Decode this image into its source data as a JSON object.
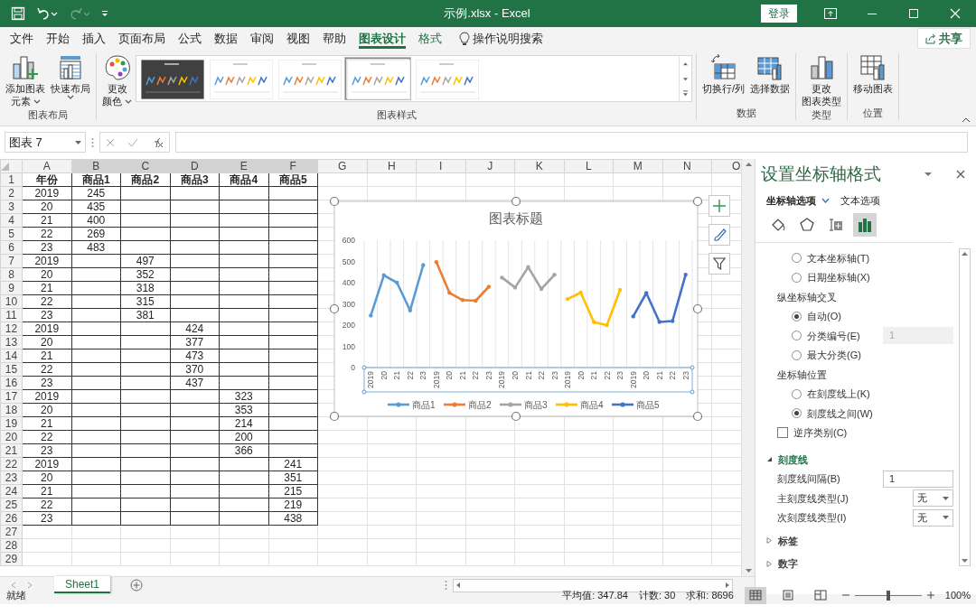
{
  "window": {
    "title": "示例.xlsx - Excel",
    "signin": "登录"
  },
  "quick_access": {
    "redo_disabled": true
  },
  "ribbon_tabs": [
    {
      "label": "文件",
      "selected": false,
      "kind": "normal"
    },
    {
      "label": "开始",
      "selected": false,
      "kind": "normal"
    },
    {
      "label": "插入",
      "selected": false,
      "kind": "normal"
    },
    {
      "label": "页面布局",
      "selected": false,
      "kind": "normal"
    },
    {
      "label": "公式",
      "selected": false,
      "kind": "normal"
    },
    {
      "label": "数据",
      "selected": false,
      "kind": "normal"
    },
    {
      "label": "审阅",
      "selected": false,
      "kind": "normal"
    },
    {
      "label": "视图",
      "selected": false,
      "kind": "normal"
    },
    {
      "label": "帮助",
      "selected": false,
      "kind": "normal"
    },
    {
      "label": "图表设计",
      "selected": true,
      "kind": "contextual"
    },
    {
      "label": "格式",
      "selected": false,
      "kind": "contextual"
    }
  ],
  "tell_me": "操作说明搜索",
  "share": "共享",
  "ribbon_groups": [
    {
      "label": "图表布局",
      "items": [
        {
          "kind": "button",
          "lines": [
            "添加图表",
            "元素"
          ],
          "dropdown": true
        },
        {
          "kind": "button",
          "lines": [
            "快速布局"
          ],
          "dropdown": true
        }
      ]
    },
    {
      "label": "图表样式",
      "items": [
        {
          "kind": "button",
          "lines": [
            "更改",
            "颜色"
          ],
          "dropdown": true
        },
        {
          "kind": "gallery",
          "thumbnails": [
            {
              "kind": "dark",
              "selected": false
            },
            {
              "kind": "light",
              "selected": false
            },
            {
              "kind": "light",
              "selected": false
            },
            {
              "kind": "light",
              "selected": true
            },
            {
              "kind": "light",
              "selected": false
            }
          ]
        }
      ]
    },
    {
      "label": "数据",
      "items": [
        {
          "kind": "button",
          "lines": [
            "切换行/列"
          ],
          "dropdown": false
        },
        {
          "kind": "button",
          "lines": [
            "选择数据"
          ],
          "dropdown": false
        }
      ]
    },
    {
      "label": "类型",
      "items": [
        {
          "kind": "button",
          "lines": [
            "更改",
            "图表类型"
          ],
          "dropdown": false
        }
      ]
    },
    {
      "label": "位置",
      "items": [
        {
          "kind": "button",
          "lines": [
            "移动图表"
          ],
          "dropdown": false
        }
      ]
    }
  ],
  "formula_bar": {
    "name_box": "图表 7"
  },
  "grid": {
    "columns": [
      {
        "letter": "A",
        "highlighted": false
      },
      {
        "letter": "B",
        "highlighted": true
      },
      {
        "letter": "C",
        "highlighted": true
      },
      {
        "letter": "D",
        "highlighted": true
      },
      {
        "letter": "E",
        "highlighted": true
      },
      {
        "letter": "F",
        "highlighted": true
      },
      {
        "letter": "G",
        "highlighted": false
      },
      {
        "letter": "H",
        "highlighted": false
      },
      {
        "letter": "I",
        "highlighted": false
      },
      {
        "letter": "J",
        "highlighted": false
      },
      {
        "letter": "K",
        "highlighted": false
      },
      {
        "letter": "L",
        "highlighted": false
      },
      {
        "letter": "M",
        "highlighted": false
      },
      {
        "letter": "N",
        "highlighted": false
      },
      {
        "letter": "O",
        "highlighted": false
      }
    ],
    "rows": [
      {
        "number": "1",
        "kind": "header",
        "cells": [
          "年份",
          "商品1",
          "商品2",
          "商品3",
          "商品4",
          "商品5"
        ]
      },
      {
        "number": "2",
        "kind": "data",
        "cells": [
          "2019",
          "245",
          null,
          null,
          null,
          null
        ]
      },
      {
        "number": "3",
        "kind": "data",
        "cells": [
          "20",
          "435",
          null,
          null,
          null,
          null
        ]
      },
      {
        "number": "4",
        "kind": "data",
        "cells": [
          "21",
          "400",
          null,
          null,
          null,
          null
        ]
      },
      {
        "number": "5",
        "kind": "data",
        "cells": [
          "22",
          "269",
          null,
          null,
          null,
          null
        ]
      },
      {
        "number": "6",
        "kind": "data",
        "cells": [
          "23",
          "483",
          null,
          null,
          null,
          null
        ]
      },
      {
        "number": "7",
        "kind": "data",
        "cells": [
          "2019",
          null,
          "497",
          null,
          null,
          null
        ]
      },
      {
        "number": "8",
        "kind": "data",
        "cells": [
          "20",
          null,
          "352",
          null,
          null,
          null
        ]
      },
      {
        "number": "9",
        "kind": "data",
        "cells": [
          "21",
          null,
          "318",
          null,
          null,
          null
        ]
      },
      {
        "number": "10",
        "kind": "data",
        "cells": [
          "22",
          null,
          "315",
          null,
          null,
          null
        ]
      },
      {
        "number": "11",
        "kind": "data",
        "cells": [
          "23",
          null,
          "381",
          null,
          null,
          null
        ]
      },
      {
        "number": "12",
        "kind": "data",
        "cells": [
          "2019",
          null,
          null,
          "424",
          null,
          null
        ]
      },
      {
        "number": "13",
        "kind": "data",
        "cells": [
          "20",
          null,
          null,
          "377",
          null,
          null
        ]
      },
      {
        "number": "14",
        "kind": "data",
        "cells": [
          "21",
          null,
          null,
          "473",
          null,
          null
        ]
      },
      {
        "number": "15",
        "kind": "data",
        "cells": [
          "22",
          null,
          null,
          "370",
          null,
          null
        ]
      },
      {
        "number": "16",
        "kind": "data",
        "cells": [
          "23",
          null,
          null,
          "437",
          null,
          null
        ]
      },
      {
        "number": "17",
        "kind": "data",
        "cells": [
          "2019",
          null,
          null,
          null,
          "323",
          null
        ]
      },
      {
        "number": "18",
        "kind": "data",
        "cells": [
          "20",
          null,
          null,
          null,
          "353",
          null
        ]
      },
      {
        "number": "19",
        "kind": "data",
        "cells": [
          "21",
          null,
          null,
          null,
          "214",
          null
        ]
      },
      {
        "number": "20",
        "kind": "data",
        "cells": [
          "22",
          null,
          null,
          null,
          "200",
          null
        ]
      },
      {
        "number": "21",
        "kind": "data",
        "cells": [
          "23",
          null,
          null,
          null,
          "366",
          null
        ]
      },
      {
        "number": "22",
        "kind": "data",
        "cells": [
          "2019",
          null,
          null,
          null,
          null,
          "241"
        ]
      },
      {
        "number": "23",
        "kind": "data",
        "cells": [
          "20",
          null,
          null,
          null,
          null,
          "351"
        ]
      },
      {
        "number": "24",
        "kind": "data",
        "cells": [
          "21",
          null,
          null,
          null,
          null,
          "215"
        ]
      },
      {
        "number": "25",
        "kind": "data",
        "cells": [
          "22",
          null,
          null,
          null,
          null,
          "219"
        ]
      },
      {
        "number": "26",
        "kind": "data",
        "cells": [
          "23",
          null,
          null,
          null,
          null,
          "438"
        ]
      },
      {
        "number": "27",
        "kind": "blank"
      },
      {
        "number": "28",
        "kind": "blank"
      },
      {
        "number": "29",
        "kind": "blank"
      }
    ]
  },
  "chart": {
    "chart_data": {
      "type": "line",
      "title": "图表标题",
      "legend": "bottom",
      "categories": [
        "2019",
        "20",
        "21",
        "22",
        "23",
        "2019",
        "20",
        "21",
        "22",
        "23",
        "2019",
        "20",
        "21",
        "22",
        "23",
        "2019",
        "20",
        "21",
        "22",
        "23",
        "2019",
        "20",
        "21",
        "22",
        "23"
      ],
      "ylim": [
        0,
        600
      ],
      "yticks": [
        0,
        100,
        200,
        300,
        400,
        500,
        600
      ],
      "series": [
        {
          "name": "商品1",
          "color": "#5b9bd5",
          "values": [
            245,
            435,
            400,
            269,
            483,
            null,
            null,
            null,
            null,
            null,
            null,
            null,
            null,
            null,
            null,
            null,
            null,
            null,
            null,
            null,
            null,
            null,
            null,
            null,
            null
          ]
        },
        {
          "name": "商品2",
          "color": "#ed7d31",
          "values": [
            null,
            null,
            null,
            null,
            null,
            497,
            352,
            318,
            315,
            381,
            null,
            null,
            null,
            null,
            null,
            null,
            null,
            null,
            null,
            null,
            null,
            null,
            null,
            null,
            null
          ]
        },
        {
          "name": "商品3",
          "color": "#a5a5a5",
          "values": [
            null,
            null,
            null,
            null,
            null,
            null,
            null,
            null,
            null,
            null,
            424,
            377,
            473,
            370,
            437,
            null,
            null,
            null,
            null,
            null,
            null,
            null,
            null,
            null,
            null
          ]
        },
        {
          "name": "商品4",
          "color": "#ffc000",
          "values": [
            null,
            null,
            null,
            null,
            null,
            null,
            null,
            null,
            null,
            null,
            null,
            null,
            null,
            null,
            null,
            323,
            353,
            214,
            200,
            366,
            null,
            null,
            null,
            null,
            null
          ]
        },
        {
          "name": "商品5",
          "color": "#4472c4",
          "values": [
            null,
            null,
            null,
            null,
            null,
            null,
            null,
            null,
            null,
            null,
            null,
            null,
            null,
            null,
            null,
            null,
            null,
            null,
            null,
            null,
            241,
            351,
            215,
            219,
            438
          ]
        }
      ]
    }
  },
  "format_pane": {
    "title": "设置坐标轴格式",
    "tabs": [
      {
        "label": "坐标轴选项",
        "selected": true
      },
      {
        "label": "文本选项",
        "selected": false
      }
    ],
    "icon_tabs": [
      {
        "selected": false
      },
      {
        "selected": false
      },
      {
        "selected": false
      },
      {
        "selected": true
      }
    ],
    "options": [
      {
        "kind": "radio",
        "label": "文本坐标轴(T)",
        "selected": false
      },
      {
        "kind": "radio",
        "label": "日期坐标轴(X)",
        "selected": false
      },
      {
        "kind": "heading",
        "label": "纵坐标轴交叉"
      },
      {
        "kind": "radio",
        "label": "自动(O)",
        "selected": true
      },
      {
        "kind": "radio",
        "label": "分类编号(E)",
        "selected": false,
        "field": {
          "value": "1",
          "disabled": true
        }
      },
      {
        "kind": "radio",
        "label": "最大分类(G)",
        "selected": false
      },
      {
        "kind": "heading",
        "label": "坐标轴位置"
      },
      {
        "kind": "radio",
        "label": "在刻度线上(K)",
        "selected": false
      },
      {
        "kind": "radio",
        "label": "刻度线之间(W)",
        "selected": true
      },
      {
        "kind": "checkbox",
        "label": "逆序类别(C)",
        "checked": false
      },
      {
        "kind": "section",
        "label": "刻度线",
        "expanded": true
      },
      {
        "kind": "field",
        "label": "刻度线间隔(B)",
        "value": "1"
      },
      {
        "kind": "select",
        "label": "主刻度线类型(J)",
        "value": "无"
      },
      {
        "kind": "select",
        "label": "次刻度线类型(I)",
        "value": "无"
      },
      {
        "kind": "section",
        "label": "标签",
        "expanded": false
      },
      {
        "kind": "section",
        "label": "数字",
        "expanded": false
      }
    ]
  },
  "sheet_tabs": [
    {
      "label": "Sheet1",
      "selected": true
    }
  ],
  "status_bar": {
    "ready": "就绪",
    "stats": [
      "平均值: 347.84",
      "计数: 30",
      "求和: 8696"
    ],
    "views": [
      {
        "selected": true
      },
      {
        "selected": false
      },
      {
        "selected": false
      }
    ],
    "zoom": {
      "level": 0.5,
      "label": "100%"
    }
  }
}
